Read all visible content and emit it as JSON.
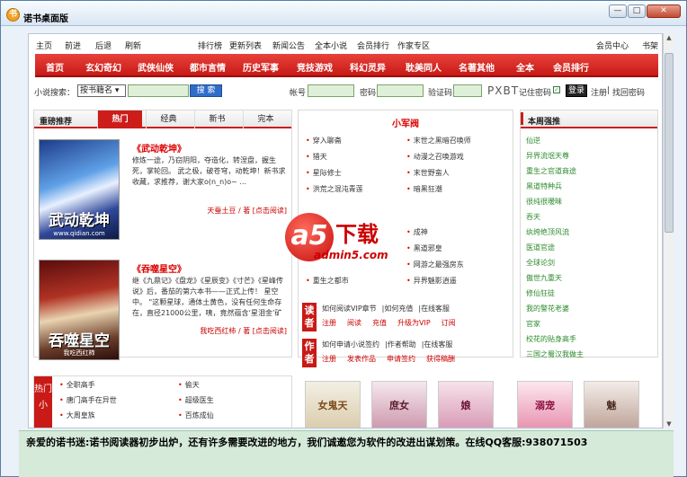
{
  "window": {
    "title": "诺书桌面版",
    "logo_glyph": "书",
    "min": "—",
    "max": "□",
    "close": "✕"
  },
  "topnav": [
    "主页",
    "前进",
    "后退",
    "刷新",
    "排行榜",
    "更新列表",
    "新闻公告",
    "全本小说",
    "会员排行",
    "作家专区",
    "会员中心",
    "书架"
  ],
  "categories": [
    "首页",
    "玄幻奇幻",
    "武侠仙侠",
    "都市言情",
    "历史军事",
    "竞技游戏",
    "科幻灵异",
    "耽美同人",
    "名著其他",
    "全本",
    "会员排行"
  ],
  "login": {
    "search_label": "小说搜索：",
    "search_type": "按书籍名 ▾",
    "search_button": "搜 索",
    "account_label": "帐号",
    "password_label": "密码",
    "captcha_label": "验证码",
    "captcha_text": "PXBT",
    "remember_label": "记住密码",
    "login_button": "登录",
    "register_link": "注册",
    "recover_link": "找回密码"
  },
  "recommend": {
    "header": "重磅推荐",
    "tabs": [
      "热门",
      "经典",
      "新书",
      "完本"
    ],
    "books": [
      {
        "title": "《武动乾坤》",
        "desc": "修炼一途，乃窃阴阳，夺造化，转涅盘，握生死，掌轮回。 武之极，破苍穹，动乾坤！新书求收藏，求推荐，谢大家o(n_n)o~ ...",
        "author": "天蚕土豆",
        "tag": "[点击阅读]",
        "cover_title": "武动乾坤",
        "cover_sub": "www.qidian.com"
      },
      {
        "title": "《吞噬星空》",
        "desc": "继《九鼎记》《盘龙》《星辰变》《寸芒》《星峰传说》后，番茄的第六本书——正式上传！ 星空中。 \"这颗星球，通体土黄色，没有任何生命存在，直径21000公里，咦，竟然蕴含‘星泪金’矿脉，真是天助我也，...",
        "author": "我吃西红柿",
        "tag": "[点击阅读]",
        "cover_title": "吞噬星空",
        "cover_sub": "我吃西红柿"
      }
    ]
  },
  "center": {
    "title": "小军阀",
    "col1": [
      "穿入聊斋",
      "猎天",
      "星际修士",
      "洪荒之混沌青莲",
      "",
      "",
      "",
      "重生之都市"
    ],
    "col2": [
      "末世之黑暗召唤师",
      "动漫之召唤游戏",
      "末世野蛮人",
      "暗黑狂潮",
      "成神",
      "黑道邪皇",
      "网游之最强房东",
      "异界魅影逍遥"
    ],
    "reader": {
      "badge": "读者",
      "row1": [
        "如何阅读VIP章节",
        "如何充值",
        "在线客服"
      ],
      "row2": [
        "注册",
        "阅读",
        "充值",
        "升级为VIP",
        "订阅"
      ]
    },
    "author": {
      "badge": "作者",
      "row1": [
        "如何申请小说签约",
        "作者帮助",
        "在线客服"
      ],
      "row2": [
        "注册",
        "发表作品",
        "申请签约",
        "获得稿酬"
      ]
    }
  },
  "weekly": {
    "header": "本周强推",
    "items": [
      "仙逆",
      "异界流氓天尊",
      "重生之官道商途",
      "黑道特种兵",
      "很纯很暧昧",
      "吞天",
      "纨绔绝顶风流",
      "医道官途",
      "全球论剑",
      "傲世九重天",
      "修仙狂徒",
      "我的警花老婆",
      "官家",
      "校花的贴身高手",
      "三国之蜀汉我做主"
    ]
  },
  "hot": {
    "badge": "热门小",
    "col1": [
      "全职高手",
      "唐门高手在异世",
      "大周皇族"
    ],
    "col2": [
      "偷天",
      "超级医生",
      "百炼成仙"
    ]
  },
  "thumbs": [
    "女鬼天",
    "庶女",
    "娘",
    "溺宠",
    "魅"
  ],
  "watermark": {
    "a5": "a5",
    "xz": "下载",
    "domain": "admin5.com"
  },
  "status": "亲爱的诺书迷:诺书阅读器初步出炉，还有许多需要改进的地方，我们诚邀您为软件的改进出谋划策。在线QQ客服:938071503"
}
